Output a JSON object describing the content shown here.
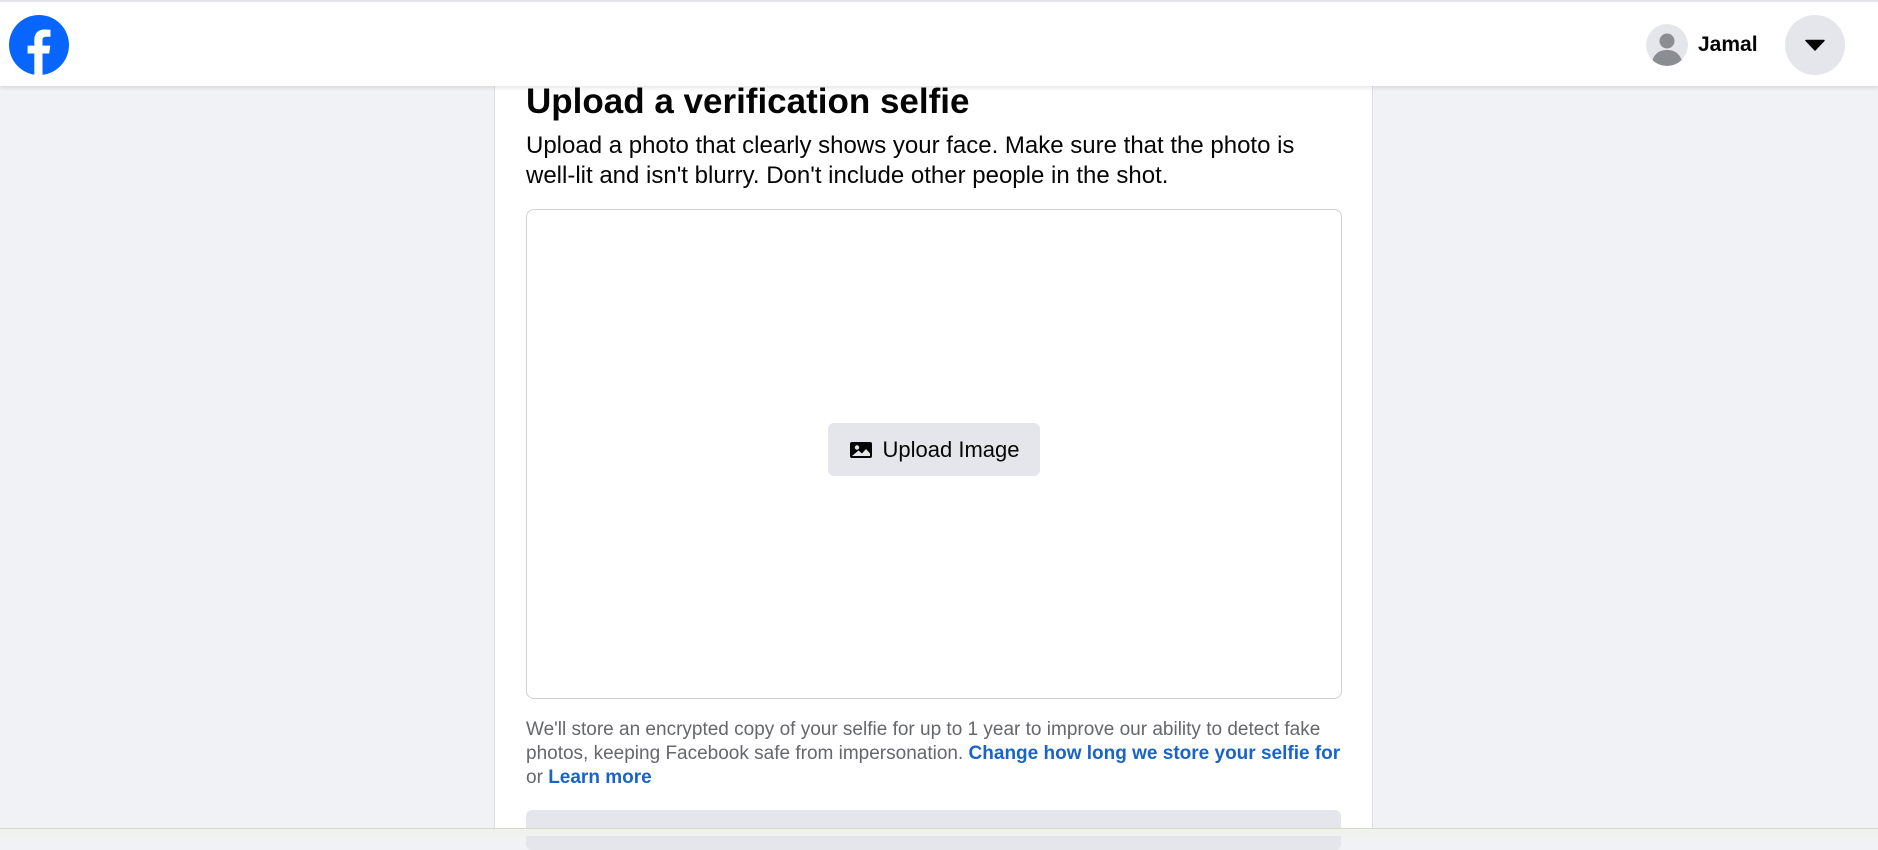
{
  "header": {
    "logo_icon": "facebook-logo-icon",
    "brand_color": "#0866ff",
    "user_name": "Jamal",
    "avatar_icon": "default-avatar-icon",
    "menu_icon": "caret-down-icon"
  },
  "main": {
    "title": "Upload a verification selfie",
    "description": "Upload a photo that clearly shows your face. Make sure that the photo is well-lit and isn't blurry. Don't include other people in the shot.",
    "upload_button_label": "Upload Image",
    "upload_icon": "image-icon",
    "footnote_text": "We'll store an encrypted copy of your selfie for up to 1 year to improve our ability to detect fake photos, keeping Facebook safe from impersonation.",
    "change_link": "Change how long we store your selfie for",
    "or_text": "or",
    "learn_more_link": "Learn more",
    "link_color": "#1a63c7"
  }
}
